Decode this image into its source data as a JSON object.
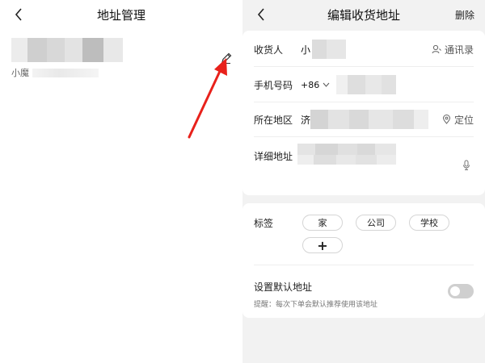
{
  "list_screen": {
    "title": "地址管理",
    "name_prefix": "小魔"
  },
  "edit_screen": {
    "title": "编辑收货地址",
    "delete_label": "删除",
    "fields": {
      "recipient": {
        "label": "收货人",
        "value_prefix": "小",
        "action_label": "通讯录",
        "action_icon": "contact-icon"
      },
      "phone": {
        "label": "手机号码",
        "country_code": "+86"
      },
      "region": {
        "label": "所在地区",
        "value_prefix": "济",
        "action_label": "定位",
        "action_icon": "location-pin-icon"
      },
      "detail": {
        "label": "详细地址",
        "action_icon": "microphone-icon"
      }
    },
    "tags": {
      "label": "标签",
      "items": [
        "家",
        "公司",
        "学校"
      ],
      "add_label": "+"
    },
    "default_address": {
      "label": "设置默认地址",
      "hint": "提醒：每次下单会默认推荐使用该地址",
      "enabled": false
    }
  },
  "colors": {
    "annotation_arrow": "#e8211b",
    "page_bg": "#f2f2f2",
    "toggle_off": "#cfcfcf"
  }
}
